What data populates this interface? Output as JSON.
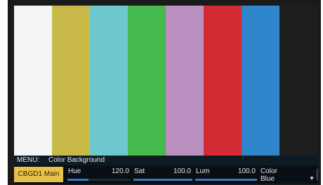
{
  "color_bars": [
    {
      "name": "white",
      "color": "#f5f5f5"
    },
    {
      "name": "yellow",
      "color": "#c9b948"
    },
    {
      "name": "cyan",
      "color": "#6ec7cc"
    },
    {
      "name": "green",
      "color": "#45b84e"
    },
    {
      "name": "magenta",
      "color": "#b98fbf"
    },
    {
      "name": "red",
      "color": "#d42a33"
    },
    {
      "name": "blue",
      "color": "#2f86cd"
    },
    {
      "name": "black",
      "color": "#1e1e1e"
    }
  ],
  "menu": {
    "key": "MENU:",
    "title": "Color Background",
    "preset": "CBGD1 Main"
  },
  "params": {
    "hue": {
      "label": "Hue",
      "value": "120.0",
      "level": 0.33
    },
    "sat": {
      "label": "Sat",
      "value": "100.0",
      "level": 1.0
    },
    "lum": {
      "label": "Lum",
      "value": "100.0",
      "level": 1.0
    }
  },
  "color_select": {
    "label": "Color",
    "value": "Blue",
    "icon": "dropdown-caret-icon",
    "glyph": "▼"
  }
}
